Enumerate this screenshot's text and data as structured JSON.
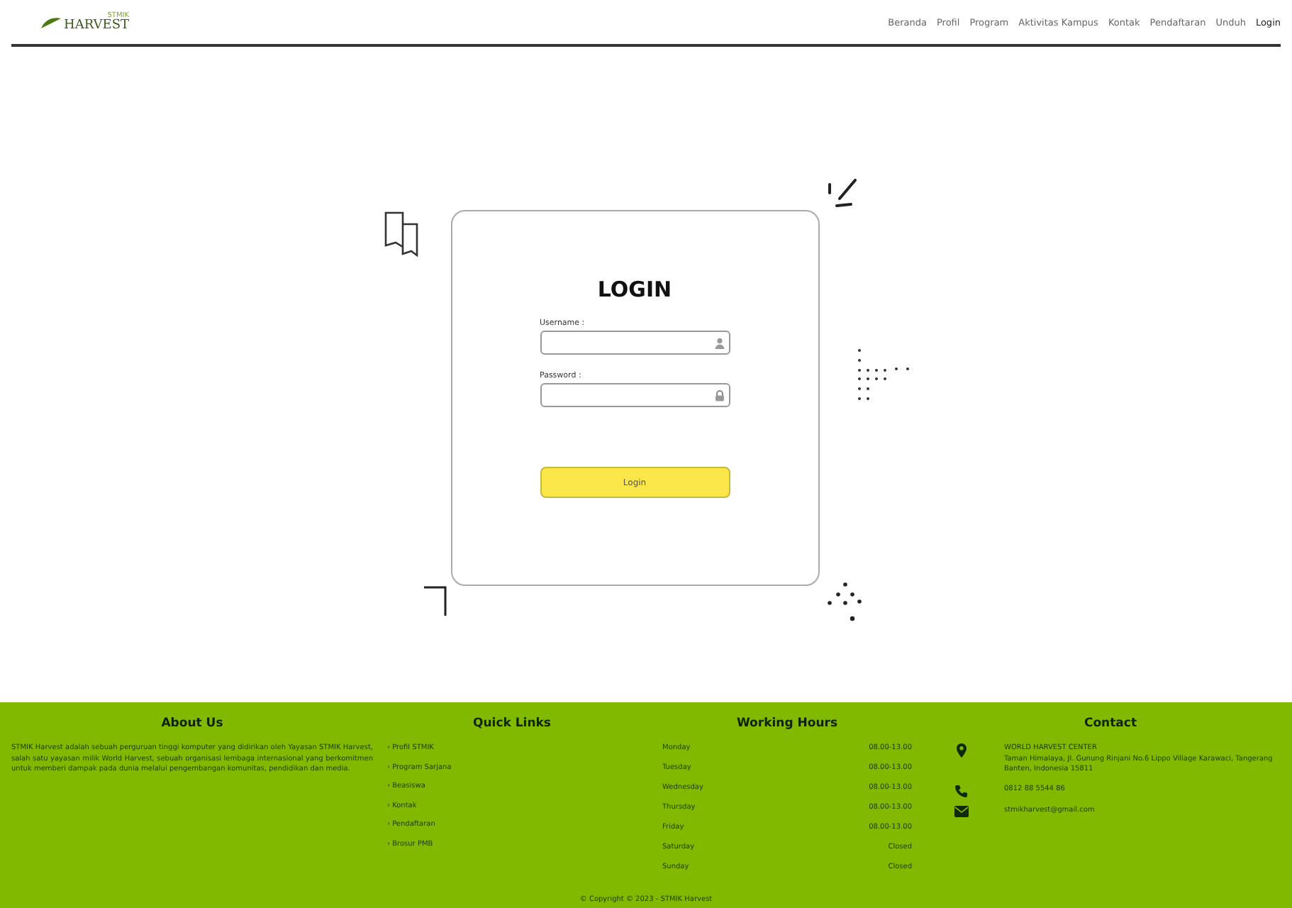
{
  "header": {
    "logo_tagline": "STMIK",
    "logo_text": "HARVEST",
    "nav": [
      {
        "label": "Beranda",
        "selected": false
      },
      {
        "label": "Profil",
        "selected": false
      },
      {
        "label": "Program",
        "selected": false
      },
      {
        "label": "Aktivitas Kampus",
        "selected": false
      },
      {
        "label": "Kontak",
        "selected": false
      },
      {
        "label": "Pendaftaran",
        "selected": false
      },
      {
        "label": "Unduh",
        "selected": false
      },
      {
        "label": "Login",
        "selected": true
      }
    ]
  },
  "login": {
    "title": "LOGIN",
    "fields": [
      {
        "label": "Username :",
        "kind": "text"
      },
      {
        "label": "Password :",
        "kind": "password"
      }
    ],
    "button": "Login"
  },
  "footer": {
    "about": {
      "title": "About Us",
      "text": "STMIK Harvest adalah sebuah perguruan tinggi komputer yang didirikan oleh Yayasan STMIK Harvest, salah satu yayasan milik World Harvest, sebuah organisasi lembaga internasional yang berkomitmen untuk memberi dampak pada dunia melalui pengembangan komunitas, pendidikan dan media."
    },
    "quick_links": {
      "title": "Quick Links",
      "items": [
        "› Profil STMIK",
        "› Program Sarjana",
        "› Beasiswa",
        "› Kontak",
        "› Pendaftaran",
        "› Brosur PMB"
      ]
    },
    "hours": {
      "title": "Working Hours",
      "rows": [
        {
          "day": "Monday",
          "time": "08.00-13.00"
        },
        {
          "day": "Tuesday",
          "time": "08.00-13.00"
        },
        {
          "day": "Wednesday",
          "time": "08.00-13.00"
        },
        {
          "day": "Thursday",
          "time": "08.00-13.00"
        },
        {
          "day": "Friday",
          "time": "08.00-13.00"
        },
        {
          "day": "Saturday",
          "time": "Closed"
        },
        {
          "day": "Sunday",
          "time": "Closed"
        }
      ]
    },
    "contact": {
      "title": "Contact",
      "items": [
        {
          "kind": "address",
          "lines": [
            "WORLD HARVEST CENTER",
            "Taman Himalaya, Jl. Gunung Rinjani No.6 Lippo Village Karawaci, Tangerang Banten, Indonesia 15811"
          ]
        },
        {
          "kind": "phone",
          "lines": [
            "0812 88 5544 86"
          ]
        },
        {
          "kind": "email",
          "lines": [
            "stmikharvest@gmail.com"
          ]
        }
      ]
    },
    "copyright": "© Copyright © 2023 - STMIK Harvest"
  }
}
